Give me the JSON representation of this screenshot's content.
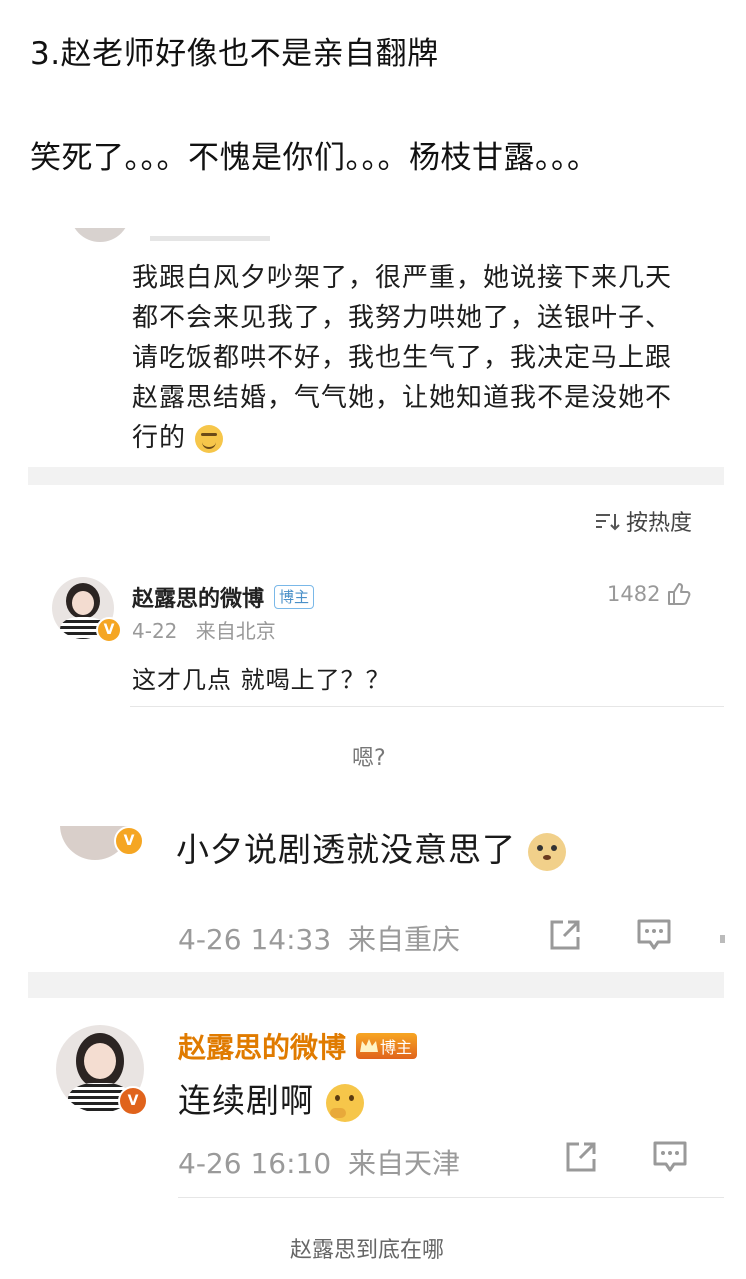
{
  "caption": {
    "line1": "3.赵老师好像也不是亲自翻牌",
    "line2": "笑死了。。。不愧是你们。。。杨枝甘露。。。"
  },
  "post": {
    "text": "我跟白风夕吵架了，很严重，她说接下来几天都不会来见我了，我努力哄她了，送银叶子、请吃饭都哄不好，我也生气了，我决定马上跟赵露思结婚，气气她，让她知道我不是没她不行的"
  },
  "sort": {
    "label": "按热度",
    "icon": "sort-icon"
  },
  "comment1": {
    "name": "赵露思的微博",
    "tag": "博主",
    "date": "4-22",
    "location": "来自北京",
    "likes": "1482",
    "text": "这才几点 就喝上了？？"
  },
  "caption_mid": "嗯?",
  "comment2": {
    "text": "小夕说剧透就没意思了",
    "time": "4-26 14:33",
    "location": "来自重庆"
  },
  "comment3": {
    "name": "赵露思的微博",
    "tag": "博主",
    "text": "连续剧啊",
    "time": "4-26 16:10",
    "location": "来自天津"
  },
  "caption_bottom": "赵露思到底在哪",
  "colors": {
    "accent_orange": "#e07b00",
    "band_gray": "#f2f2f2",
    "tag_blue": "#4a90c8"
  }
}
